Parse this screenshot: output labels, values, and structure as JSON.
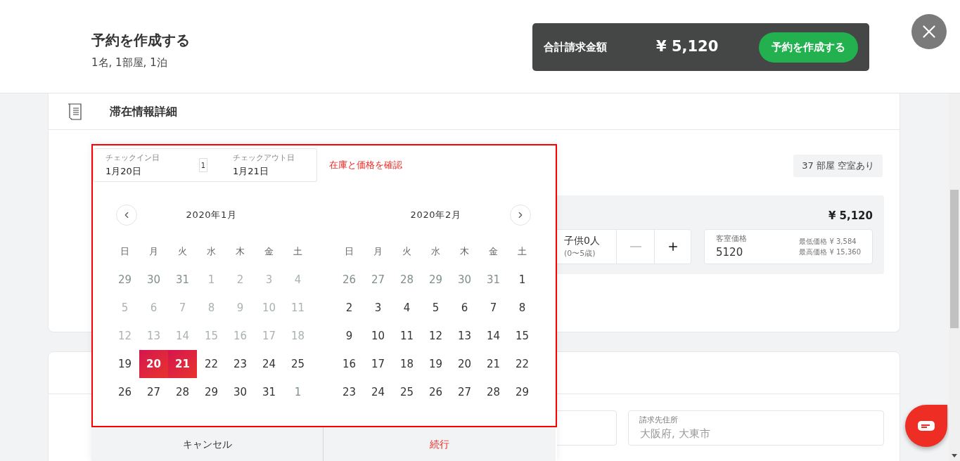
{
  "modal": {
    "title": "予約を作成する",
    "summary": "1名, 1部屋, 1泊"
  },
  "total_bar": {
    "label": "合計請求金額",
    "amount": "¥ 5,120",
    "button": "予約を作成する"
  },
  "stay": {
    "title": "滞在情報詳細",
    "availability": "37 部屋 空室あり",
    "room_total": "¥ 5,120",
    "children": {
      "label": "子供0人",
      "note": "(0〜5歳)",
      "minus_disabled": true
    },
    "price_field": {
      "label": "客室価格",
      "value": "5120",
      "min": "最低価格 ¥ 3,584",
      "max": "最高価格 ¥ 15,360"
    }
  },
  "date_picker": {
    "check_in": {
      "label": "チェックイン日",
      "value": "1月20日"
    },
    "nights": "1",
    "check_out": {
      "label": "チェックアウト日",
      "value": "1月21日"
    },
    "check_link": "在庫と価格を確認",
    "months": [
      {
        "title": "2020年1月",
        "weekdays": [
          "日",
          "月",
          "火",
          "水",
          "木",
          "金",
          "土"
        ],
        "days": [
          {
            "day": "29",
            "kind": "outside",
            "selected": false
          },
          {
            "day": "30",
            "kind": "outside",
            "selected": false
          },
          {
            "day": "31",
            "kind": "outside",
            "selected": false
          },
          {
            "day": "1",
            "kind": "past",
            "selected": false
          },
          {
            "day": "2",
            "kind": "past",
            "selected": false
          },
          {
            "day": "3",
            "kind": "past",
            "selected": false
          },
          {
            "day": "4",
            "kind": "past",
            "selected": false
          },
          {
            "day": "5",
            "kind": "past",
            "selected": false
          },
          {
            "day": "6",
            "kind": "past",
            "selected": false
          },
          {
            "day": "7",
            "kind": "past",
            "selected": false
          },
          {
            "day": "8",
            "kind": "past",
            "selected": false
          },
          {
            "day": "9",
            "kind": "past",
            "selected": false
          },
          {
            "day": "10",
            "kind": "past",
            "selected": false
          },
          {
            "day": "11",
            "kind": "past",
            "selected": false
          },
          {
            "day": "12",
            "kind": "past",
            "selected": false
          },
          {
            "day": "13",
            "kind": "past",
            "selected": false
          },
          {
            "day": "14",
            "kind": "past",
            "selected": false
          },
          {
            "day": "15",
            "kind": "past",
            "selected": false
          },
          {
            "day": "16",
            "kind": "past",
            "selected": false
          },
          {
            "day": "17",
            "kind": "past",
            "selected": false
          },
          {
            "day": "18",
            "kind": "past",
            "selected": false
          },
          {
            "day": "19",
            "kind": "available",
            "selected": false
          },
          {
            "day": "20",
            "kind": "available",
            "selected": true
          },
          {
            "day": "21",
            "kind": "available",
            "selected": true
          },
          {
            "day": "22",
            "kind": "available",
            "selected": false
          },
          {
            "day": "23",
            "kind": "available",
            "selected": false
          },
          {
            "day": "24",
            "kind": "available",
            "selected": false
          },
          {
            "day": "25",
            "kind": "available",
            "selected": false
          },
          {
            "day": "26",
            "kind": "available",
            "selected": false
          },
          {
            "day": "27",
            "kind": "available",
            "selected": false
          },
          {
            "day": "28",
            "kind": "available",
            "selected": false
          },
          {
            "day": "29",
            "kind": "available",
            "selected": false
          },
          {
            "day": "30",
            "kind": "available",
            "selected": false
          },
          {
            "day": "31",
            "kind": "available",
            "selected": false
          },
          {
            "day": "1",
            "kind": "outside",
            "selected": false
          }
        ]
      },
      {
        "title": "2020年2月",
        "weekdays": [
          "日",
          "月",
          "火",
          "水",
          "木",
          "金",
          "土"
        ],
        "days": [
          {
            "day": "26",
            "kind": "outside",
            "selected": false
          },
          {
            "day": "27",
            "kind": "outside",
            "selected": false
          },
          {
            "day": "28",
            "kind": "outside",
            "selected": false
          },
          {
            "day": "29",
            "kind": "outside",
            "selected": false
          },
          {
            "day": "30",
            "kind": "outside",
            "selected": false
          },
          {
            "day": "31",
            "kind": "outside",
            "selected": false
          },
          {
            "day": "1",
            "kind": "available",
            "selected": false
          },
          {
            "day": "2",
            "kind": "available",
            "selected": false
          },
          {
            "day": "3",
            "kind": "available",
            "selected": false
          },
          {
            "day": "4",
            "kind": "available",
            "selected": false
          },
          {
            "day": "5",
            "kind": "available",
            "selected": false
          },
          {
            "day": "6",
            "kind": "available",
            "selected": false
          },
          {
            "day": "7",
            "kind": "available",
            "selected": false
          },
          {
            "day": "8",
            "kind": "available",
            "selected": false
          },
          {
            "day": "9",
            "kind": "available",
            "selected": false
          },
          {
            "day": "10",
            "kind": "available",
            "selected": false
          },
          {
            "day": "11",
            "kind": "available",
            "selected": false
          },
          {
            "day": "12",
            "kind": "available",
            "selected": false
          },
          {
            "day": "13",
            "kind": "available",
            "selected": false
          },
          {
            "day": "14",
            "kind": "available",
            "selected": false
          },
          {
            "day": "15",
            "kind": "available",
            "selected": false
          },
          {
            "day": "16",
            "kind": "available",
            "selected": false
          },
          {
            "day": "17",
            "kind": "available",
            "selected": false
          },
          {
            "day": "18",
            "kind": "available",
            "selected": false
          },
          {
            "day": "19",
            "kind": "available",
            "selected": false
          },
          {
            "day": "20",
            "kind": "available",
            "selected": false
          },
          {
            "day": "21",
            "kind": "available",
            "selected": false
          },
          {
            "day": "22",
            "kind": "available",
            "selected": false
          },
          {
            "day": "23",
            "kind": "available",
            "selected": false
          },
          {
            "day": "24",
            "kind": "available",
            "selected": false
          },
          {
            "day": "25",
            "kind": "available",
            "selected": false
          },
          {
            "day": "26",
            "kind": "available",
            "selected": false
          },
          {
            "day": "27",
            "kind": "available",
            "selected": false
          },
          {
            "day": "28",
            "kind": "available",
            "selected": false
          },
          {
            "day": "29",
            "kind": "available",
            "selected": false
          }
        ]
      }
    ],
    "buttons": {
      "cancel": "キャンセル",
      "continue": "続行"
    }
  },
  "billing": {
    "field": {
      "label": "請求先住所",
      "placeholder": "大阪府, 大東市"
    }
  }
}
